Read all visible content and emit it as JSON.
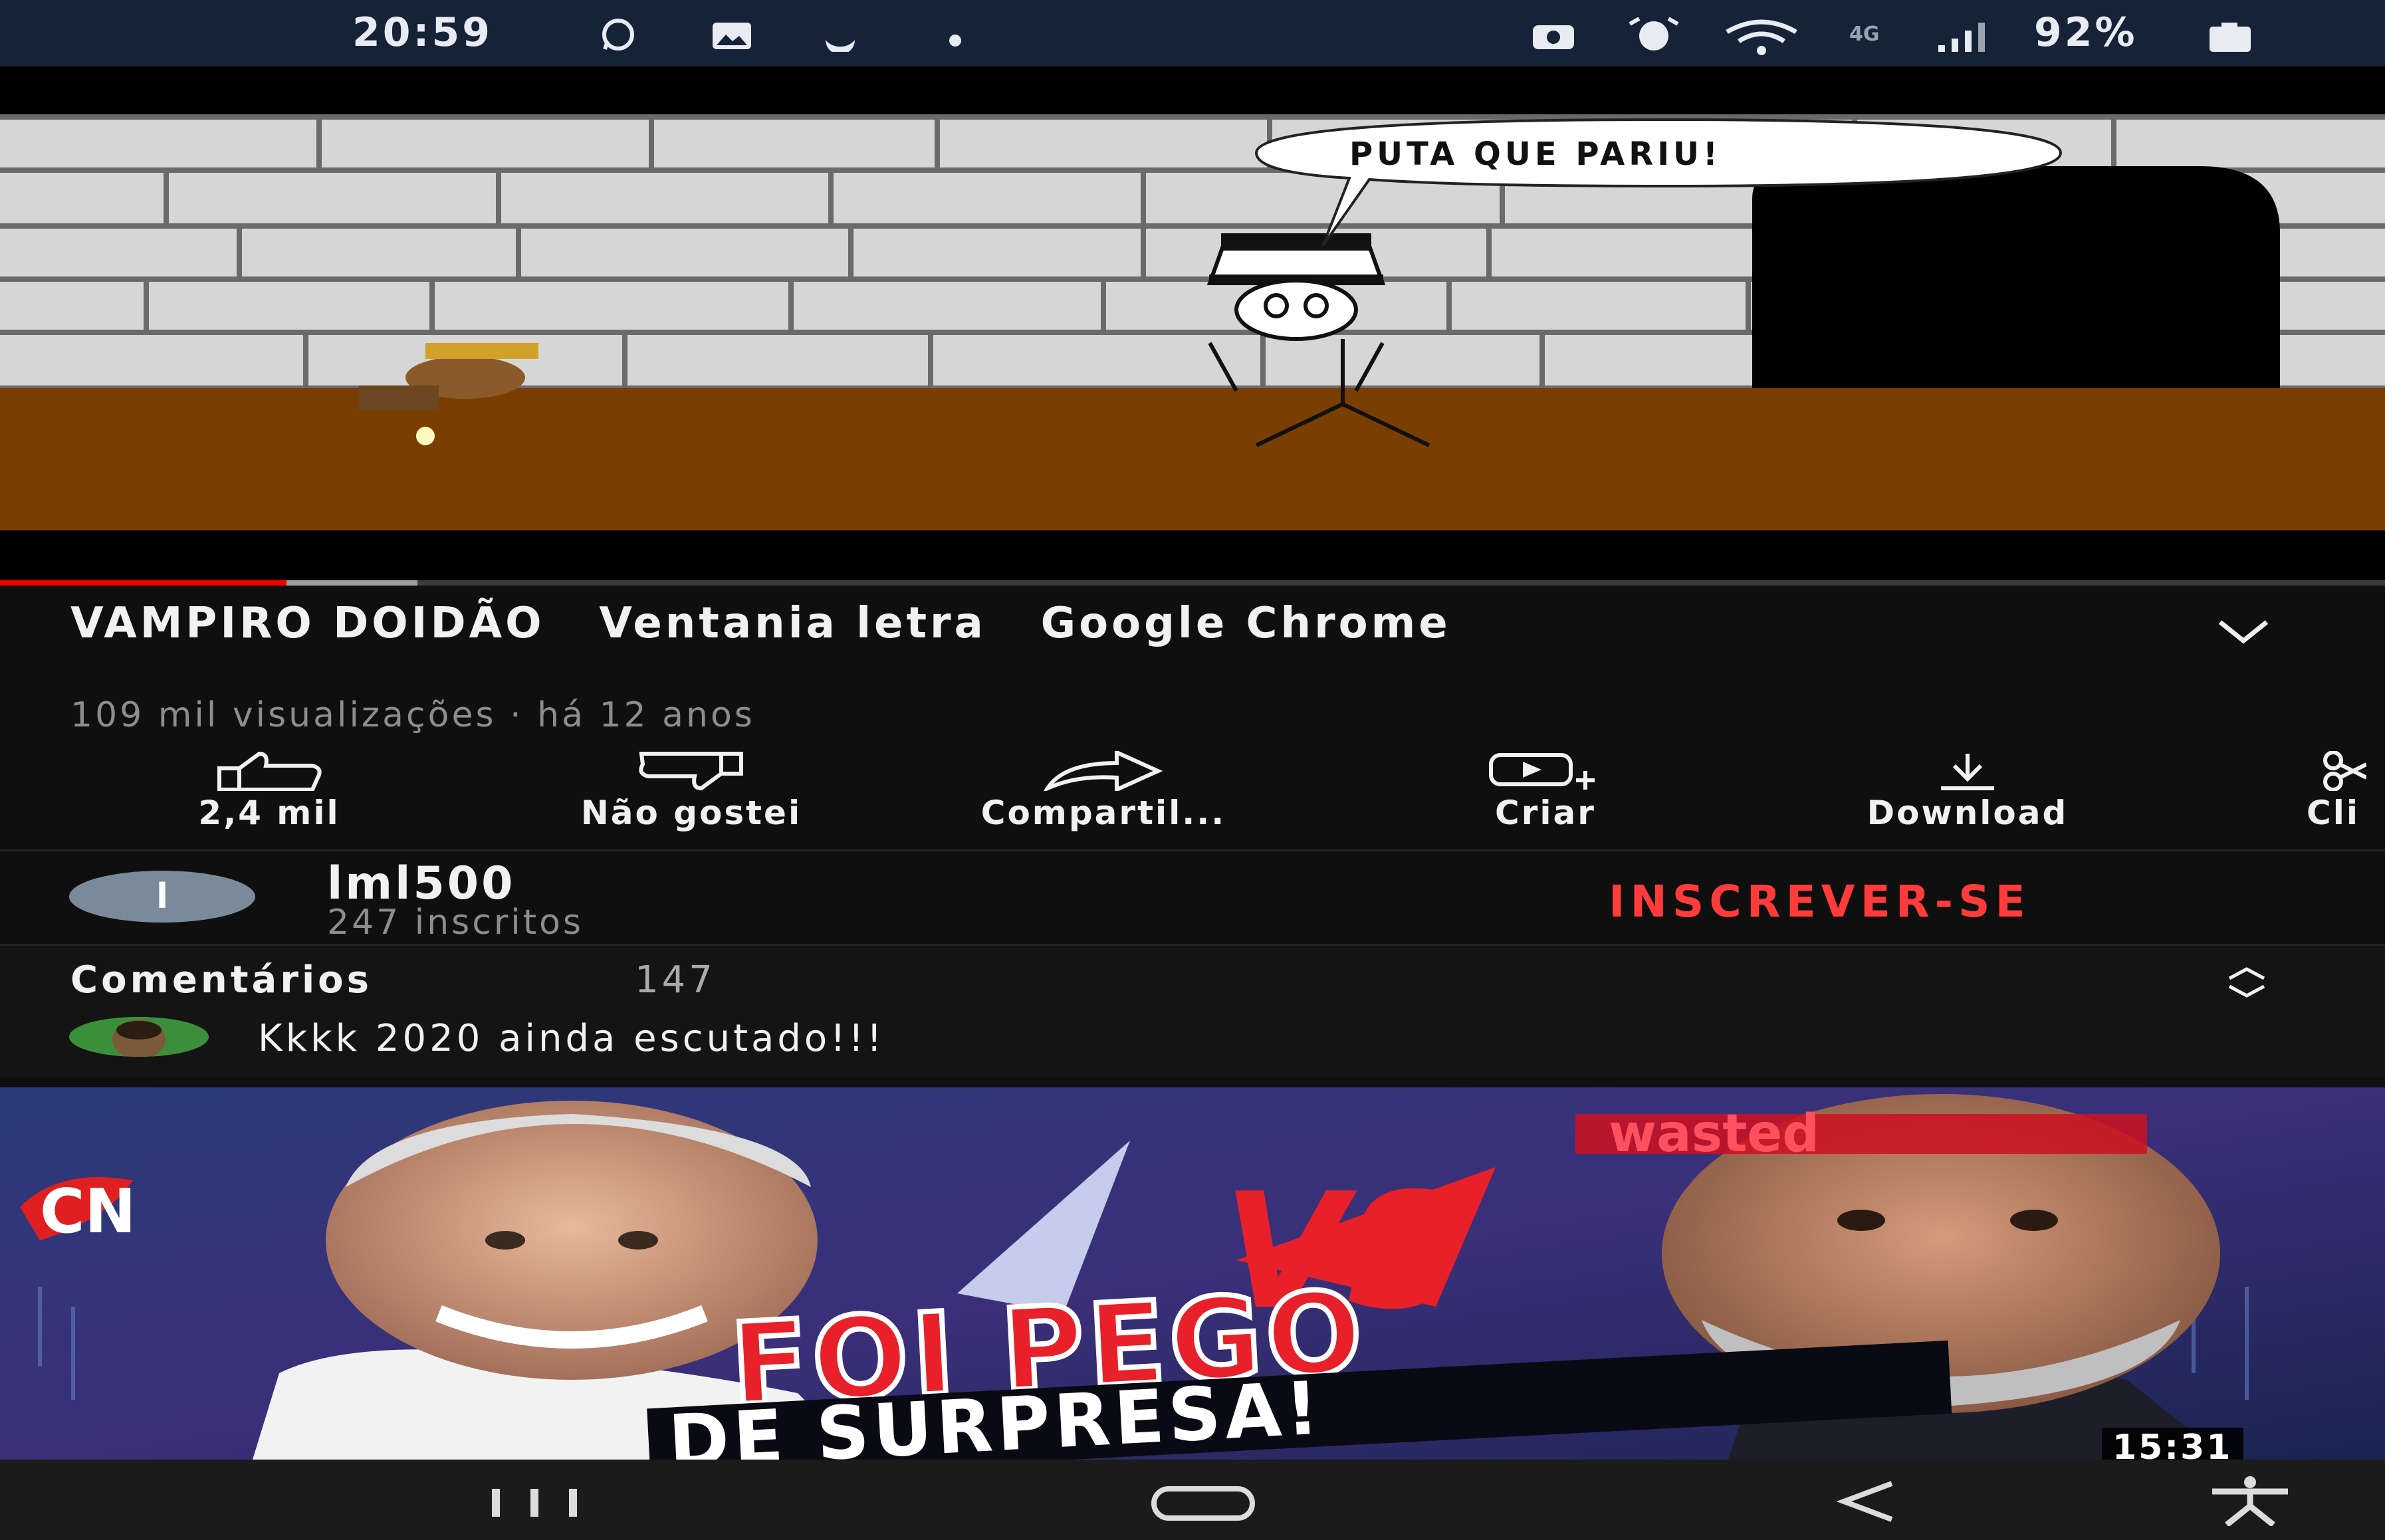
{
  "status_bar": {
    "time": "20:59",
    "left_icons": [
      "whatsapp-icon",
      "gallery-icon",
      "moon-icon",
      "dot-icon"
    ],
    "right_icons": [
      "camera-icon",
      "alarm-icon",
      "wifi-icon",
      "4g-icon",
      "signal-icon",
      "battery-icon"
    ],
    "network": "4G",
    "battery": "92%"
  },
  "player": {
    "speech_bubble": "PUTA QUE PARIU!",
    "progress_fraction": 0.12,
    "buffered_fraction": 0.175,
    "accent": "#ee0000"
  },
  "video": {
    "title": "VAMPIRO DOIDÃO   Ventania letra   Google Chrome",
    "meta": "109 mil visualizações · há 12 anos"
  },
  "actions": [
    {
      "label": "2,4 mil",
      "icon": "thumbs-up-icon"
    },
    {
      "label": "Não gostei",
      "icon": "thumbs-down-icon"
    },
    {
      "label": "Compartil...",
      "icon": "share-icon"
    },
    {
      "label": "Criar",
      "icon": "create-icon"
    },
    {
      "label": "Download",
      "icon": "download-icon"
    },
    {
      "label": "Cli",
      "icon": "clip-icon"
    }
  ],
  "channel": {
    "avatar_letter": "l",
    "name": "lml500",
    "subscribers": "247 inscritos",
    "subscribe_label": "INSCREVER-SE",
    "subscribe_color": "#ff3b3b"
  },
  "comments": {
    "heading": "Comentários",
    "count": "147",
    "top_comment": "Kkkk 2020 ainda escutado!!!"
  },
  "next_video": {
    "headline_1": "FOI PEGO",
    "headline_2": "DE SURPRESA!",
    "vs": "VS",
    "badge": "wasted",
    "logo": "CN",
    "duration": "15:31"
  },
  "nav_bar": {
    "icons": [
      "recent-apps-icon",
      "home-icon",
      "back-icon",
      "accessibility-icon"
    ]
  }
}
